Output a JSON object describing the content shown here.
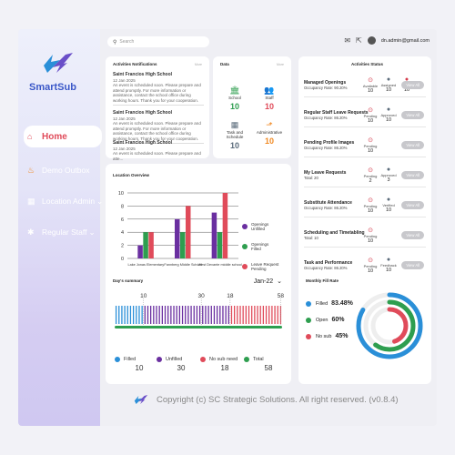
{
  "brand": {
    "name": "SmartSub"
  },
  "sidebar": {
    "items": [
      {
        "label": "Home",
        "icon": "home-icon"
      },
      {
        "label": "Demo Outbox",
        "icon": "fire-icon"
      },
      {
        "label": "Location Admin",
        "icon": "buildings-icon"
      },
      {
        "label": "Regular Staff",
        "icon": "people-icon"
      }
    ]
  },
  "header": {
    "search_placeholder": "Search",
    "user_email": "dn.admin@gmail.com"
  },
  "notifications": {
    "title": "Activities Notifications",
    "action": "More",
    "items": [
      {
        "school": "Saint Francios High School",
        "date": "12 Jan 2025",
        "body": "An event is scheduled soon. Please prepare and attend promptly. For more information or assistance, contact the school office during working hours. Thank you for your cooperation."
      },
      {
        "school": "Saint Francios High School",
        "date": "12 Jan 2025",
        "body": "An event is scheduled soon. Please prepare and attend promptly. For more information or assistance, contact the school office during working hours. Thank you for your cooperation."
      },
      {
        "school": "Saint Francios High School",
        "date": "12 Jan 2025",
        "body": "An event is scheduled soon. Please prepare and atte..."
      }
    ]
  },
  "data_card": {
    "title": "Data",
    "action": "More",
    "items": [
      {
        "label": "School",
        "value": "10",
        "icon": "school-icon",
        "color": "#2e9e4f"
      },
      {
        "label": "Staff",
        "value": "10",
        "icon": "staff-icon",
        "color": "#e04b5a"
      },
      {
        "label": "Task and Schedule",
        "value": "10",
        "icon": "calendar-icon",
        "color": "#5a6b7b"
      },
      {
        "label": "Administrative",
        "value": "10",
        "icon": "admin-icon",
        "color": "#f08a24"
      }
    ]
  },
  "activities": {
    "title": "Activities Status",
    "view_all": "View All",
    "rows": [
      {
        "name": "Managed Openings",
        "sub": "Occupancy Rate: 90.20%",
        "stats": [
          {
            "label": "Available",
            "value": "10"
          },
          {
            "label": "Assigned",
            "value": "10"
          },
          {
            "label": "Filled",
            "value": "10"
          }
        ]
      },
      {
        "name": "Regular Staff Leave Requests",
        "sub": "Occupancy Rate: 86.20%",
        "stats": [
          {
            "label": "Pending",
            "value": "10"
          },
          {
            "label": "Approved",
            "value": "10"
          }
        ]
      },
      {
        "name": "Pending Profile Images",
        "sub": "Occupancy Rate: 86.20%",
        "stats": [
          {
            "label": "Pending",
            "value": "10"
          }
        ]
      },
      {
        "name": "My Leave Requests",
        "sub": "Total: 20",
        "stats": [
          {
            "label": "Pending",
            "value": "2"
          },
          {
            "label": "Approved",
            "value": "3"
          }
        ]
      },
      {
        "name": "Substitute Attendance",
        "sub": "Occupancy Rate: 86.20%",
        "stats": [
          {
            "label": "Pending",
            "value": "10"
          },
          {
            "label": "Verified",
            "value": "10"
          }
        ]
      },
      {
        "name": "Scheduling and Timetabling",
        "sub": "Total: 10",
        "stats": [
          {
            "label": "Pending",
            "value": "10"
          }
        ]
      },
      {
        "name": "Task and Performance",
        "sub": "Occupancy Rate: 86.20%",
        "stats": [
          {
            "label": "Pending",
            "value": "10"
          },
          {
            "label": "Feedback",
            "value": "10"
          }
        ]
      }
    ]
  },
  "location_overview": {
    "title": "Location Overview",
    "legend": [
      {
        "top": "Openings",
        "bottom": "Unfilled",
        "color": "#6a2fa0"
      },
      {
        "top": "Openings",
        "bottom": "Filled",
        "color": "#2e9e4f"
      },
      {
        "top": "Leave Request",
        "bottom": "Pending",
        "color": "#e04b5a"
      }
    ]
  },
  "chart_data": {
    "type": "bar",
    "categories": [
      "Lake Jonas Elementary",
      "Fannberg Middle School",
      "West Devante middle school"
    ],
    "series": [
      {
        "name": "Openings Unfilled",
        "values": [
          2,
          6,
          7
        ],
        "color": "#6a2fa0"
      },
      {
        "name": "Openings Filled",
        "values": [
          4,
          4,
          4
        ],
        "color": "#2e9e4f"
      },
      {
        "name": "Leave Request Pending",
        "values": [
          4,
          8,
          10
        ],
        "color": "#e04b5a"
      }
    ],
    "yticks": [
      "0",
      "2",
      "4",
      "6",
      "8",
      "10"
    ],
    "ylim": [
      0,
      10
    ]
  },
  "day_summary": {
    "title": "Day's summary",
    "month": "Jan-22",
    "markers": [
      "10",
      "30",
      "18",
      "58"
    ],
    "stats": [
      {
        "label": "Filled",
        "value": "10",
        "color": "#2a8fd8"
      },
      {
        "label": "Unfilled",
        "value": "30",
        "color": "#6a2fa0"
      },
      {
        "label": "No sub need",
        "value": "18",
        "color": "#e04b5a"
      },
      {
        "label": "Total",
        "value": "58",
        "color": "#2e9e4f"
      }
    ]
  },
  "fill_rate": {
    "title": "Monthly Fill Rate",
    "items": [
      {
        "label": "Filled",
        "value": "83.48%",
        "pct": 83.48,
        "color": "#2a8fd8"
      },
      {
        "label": "Open",
        "value": "60%",
        "pct": 60,
        "color": "#2e9e4f"
      },
      {
        "label": "No sub",
        "value": "45%",
        "pct": 45,
        "color": "#e04b5a"
      }
    ]
  },
  "footer": {
    "text": "Copyright (c) SC Strategic Solutions. All right reserved. (v0.8.4)"
  }
}
